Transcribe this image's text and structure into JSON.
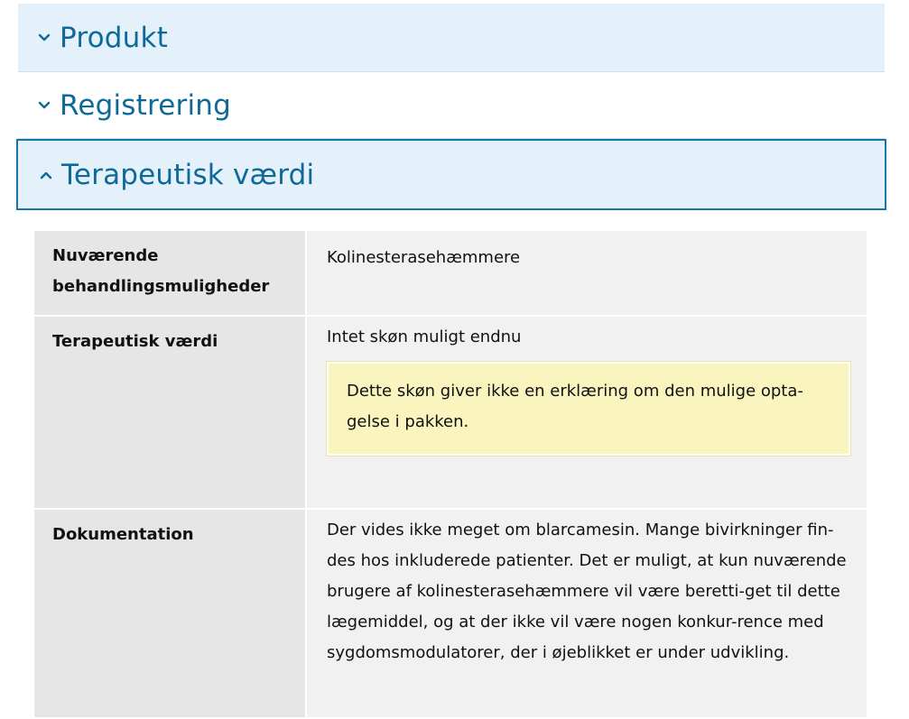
{
  "accordion": {
    "items": [
      {
        "label": "Produkt",
        "state": "collapsed"
      },
      {
        "label": "Registrering",
        "state": "collapsed"
      },
      {
        "label": "Terapeutisk værdi",
        "state": "expanded"
      }
    ]
  },
  "table": {
    "rows": [
      {
        "label": "Nuværende behandlingsmuligheder",
        "value": "Kolinesterasehæmmere"
      },
      {
        "label": "Terapeutisk værdi",
        "value": "Intet skøn muligt endnu",
        "note": "Dette skøn giver ikke en erklæring om den mulige opta-gelse i pakken."
      },
      {
        "label": "Dokumentation",
        "value": "Der vides ikke meget om blarcamesin. Mange bivirkninger fin-des hos inkluderede patienter. Det er muligt, at kun nuværende brugere af kolinesterasehæmmere vil være beretti-get til dette lægemiddel, og at der ikke vil være nogen konkur-rence med sygdomsmodulatorer, der i øjeblikket er under udvikling."
      }
    ]
  },
  "colors": {
    "accent": "#0d6a98",
    "header_bg": "#e4f0fa",
    "active_border": "#1a74a8",
    "note_bg": "#faf5bf"
  },
  "icons": {
    "collapsed": "chevron-down-icon",
    "expanded": "chevron-up-icon"
  }
}
